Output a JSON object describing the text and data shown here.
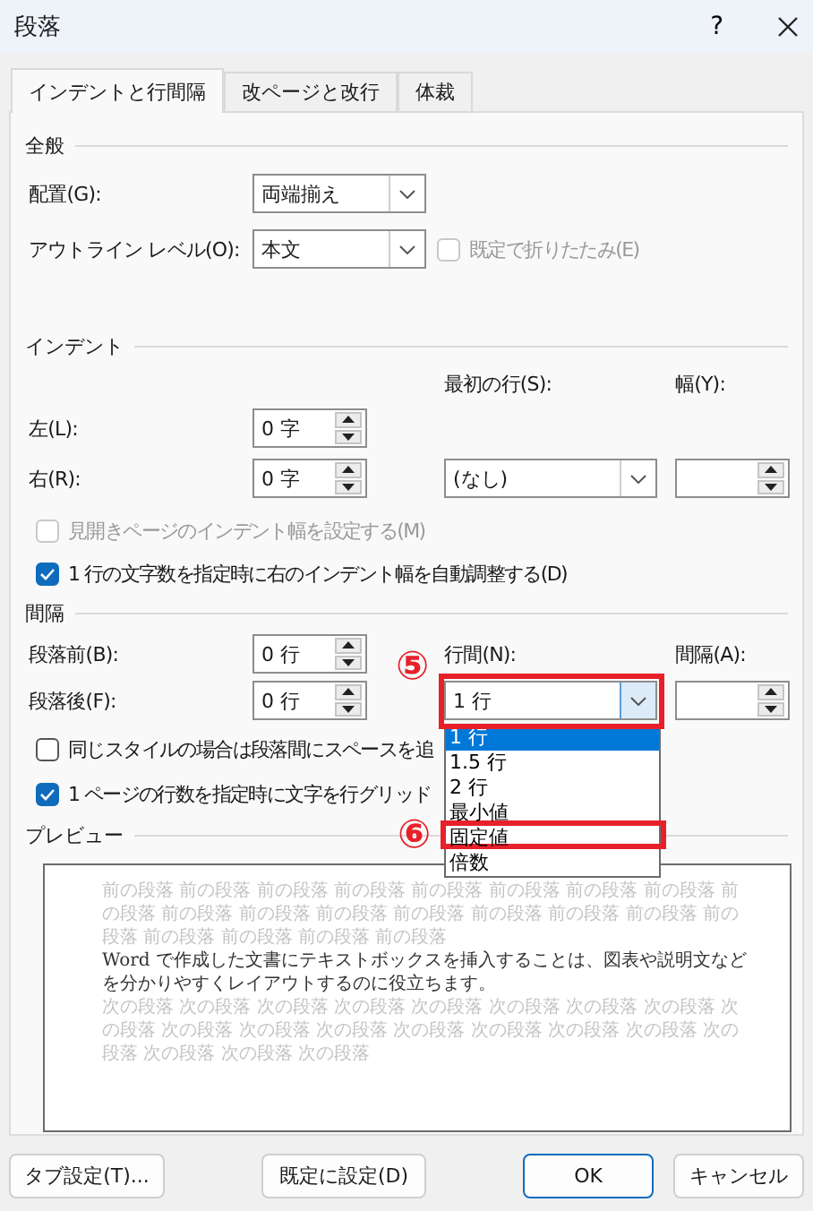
{
  "window": {
    "title": "段落",
    "help": "?"
  },
  "tabs": [
    {
      "label": "インデントと行間隔",
      "selected": true
    },
    {
      "label": "改ページと改行",
      "selected": false
    },
    {
      "label": "体裁",
      "selected": false
    }
  ],
  "general": {
    "heading": "全般",
    "alignment": {
      "label": "配置(G):",
      "value": "両端揃え"
    },
    "outline_level": {
      "label": "アウトライン レベル(O):",
      "value": "本文"
    },
    "collapse": {
      "label": "既定で折りたたみ(E)",
      "checked": false,
      "disabled": true
    }
  },
  "indent": {
    "heading": "インデント",
    "left": {
      "label": "左(L):",
      "value": "0 字"
    },
    "right": {
      "label": "右(R):",
      "value": "0 字"
    },
    "first_line": {
      "label": "最初の行(S):",
      "value": "(なし)"
    },
    "by": {
      "label": "幅(Y):"
    },
    "mirror": {
      "label": "見開きページのインデント幅を設定する(M)",
      "checked": false,
      "disabled": true
    },
    "auto_adjust": {
      "label": "1 行の文字数を指定時に右のインデント幅を自動調整する(D)",
      "checked": true,
      "disabled": false
    }
  },
  "spacing": {
    "heading": "間隔",
    "before": {
      "label": "段落前(B):",
      "value": "0 行"
    },
    "after": {
      "label": "段落後(F):",
      "value": "0 行"
    },
    "line_spacing": {
      "label": "行間(N):",
      "value": "1 行",
      "open": true,
      "callout": "⑤",
      "options": [
        {
          "label": "1 行",
          "selected": true
        },
        {
          "label": "1.5 行",
          "selected": false
        },
        {
          "label": "2 行",
          "selected": false
        },
        {
          "label": "最小値",
          "selected": false
        },
        {
          "label": "固定値",
          "selected": false,
          "callout": "⑥"
        },
        {
          "label": "倍数",
          "selected": false
        }
      ]
    },
    "at": {
      "label": "間隔(A):"
    },
    "no_space_same_style": {
      "label": "同じスタイルの場合は段落間にスペースを追",
      "checked": false,
      "disabled": false
    },
    "snap_to_grid": {
      "label": "1 ページの行数を指定時に文字を行グリッド",
      "checked": true,
      "disabled": false
    }
  },
  "preview": {
    "heading": "プレビュー",
    "previous": "前の段落 前の段落 前の段落 前の段落 前の段落 前の段落 前の段落 前の段落 前の段落 前の段落 前の段落 前の段落 前の段落 前の段落 前の段落 前の段落 前の段落 前の段落 前の段落 前の段落 前の段落",
    "sample": "Word で作成した文書にテキストボックスを挿入することは、図表や説明文などを分かりやすくレイアウトするのに役立ちます。",
    "next": "次の段落 次の段落 次の段落 次の段落 次の段落 次の段落 次の段落 次の段落 次の段落 次の段落 次の段落 次の段落 次の段落 次の段落 次の段落 次の段落 次の段落 次の段落 次の段落 次の段落"
  },
  "buttons": [
    {
      "label": "タブ設定(T)...",
      "kind": "default"
    },
    {
      "label": "既定に設定(D)",
      "kind": "default"
    },
    {
      "label": "OK",
      "kind": "primary"
    },
    {
      "label": "キャンセル",
      "kind": "default"
    }
  ]
}
